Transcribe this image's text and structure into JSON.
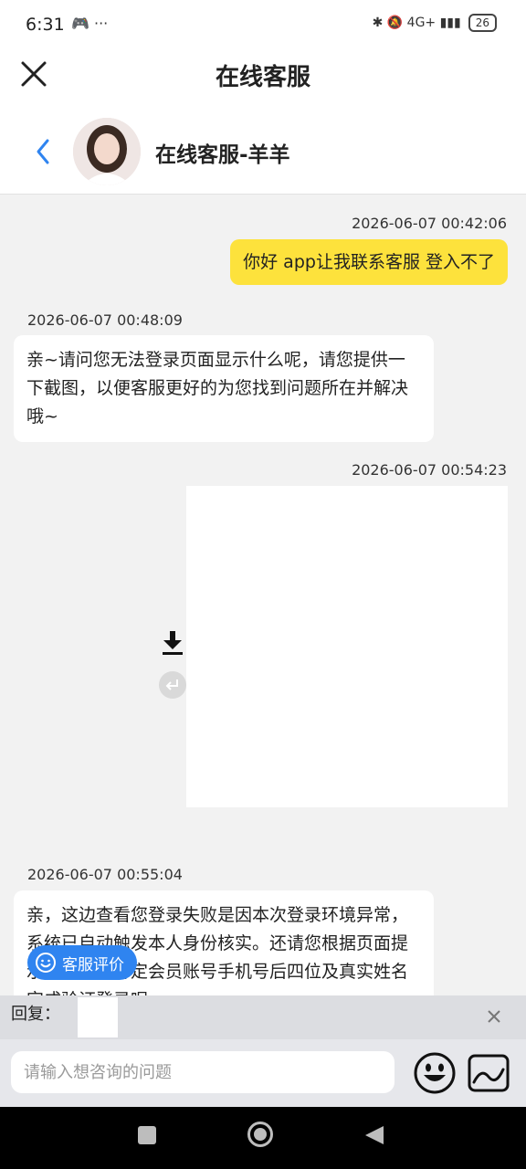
{
  "status_bar": {
    "time": "6:31",
    "left_icons": "🎮 ···",
    "right_icons": "✱ 🔕 4G+ ▮▮▮",
    "battery": "26"
  },
  "header": {
    "title": "在线客服",
    "agent_name": "在线客服-羊羊"
  },
  "messages": [
    {
      "side": "right",
      "timestamp": "2026-06-07 00:42:06",
      "text": "你好 app让我联系客服 登入不了"
    },
    {
      "side": "left",
      "timestamp": "2026-06-07 00:48:09",
      "text": "亲~请问您无法登录页面显示什么呢，请您提供一下截图，以便客服更好的为您找到问题所在并解决哦~"
    },
    {
      "side": "right",
      "timestamp": "2026-06-07 00:54:23",
      "type": "image"
    },
    {
      "side": "left",
      "timestamp": "2026-06-07 00:55:04",
      "text": "亲，这边查看您登录失败是因本次登录环境异常，系统已自动触发本人身份核实。还请您根据页面提示输入当前绑定会员账号手机号后四位及真实姓名完成验证登录呢~"
    }
  ],
  "rate_button": "客服评价",
  "reply": {
    "label": "回复："
  },
  "input": {
    "placeholder": "请输入想咨询的问题"
  },
  "colors": {
    "my_bubble": "#fde23c",
    "accent": "#2f84f0"
  }
}
